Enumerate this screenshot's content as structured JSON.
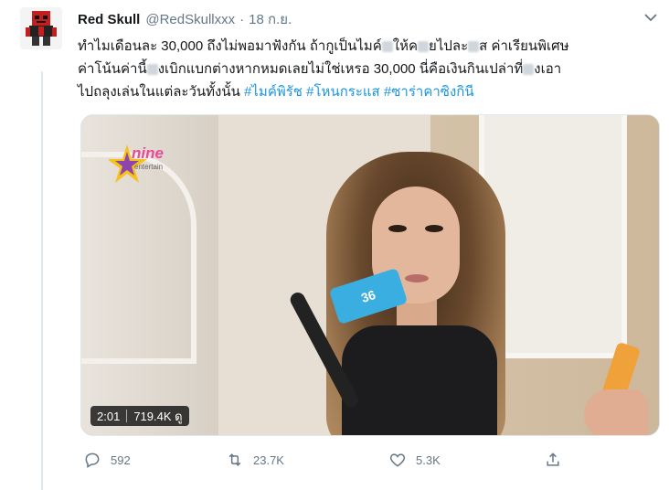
{
  "tweet": {
    "author_name": "Red Skull",
    "handle": "@RedSkullxxx",
    "separator": "·",
    "date": "18 ก.ย.",
    "text_line1_a": "ทำไมเดือนละ 30,000 ถึงไม่พอมาฟังกัน ถ้ากูเป็นไมค์",
    "text_line1_b": "ให้ค",
    "text_line1_c": "ยไปละ",
    "text_line1_d": "ส ค่าเรียนพิเศษ",
    "text_line2_a": "ค่าโน้นค่านี้",
    "text_line2_b": "งเบิกแบกต่างหากหมดเลยไม่ใช่เหรอ 30,000 นี่คือเงินกินเปล่าที่",
    "text_line2_c": "งเอา",
    "text_line3_a": "ไปถลุงเล่นในแต่ละวันทั้งนั้น ",
    "hashtags": [
      "#ไมค์พิรัช",
      "#โหนกระแส",
      "#ซาร่าคาซิงกินี"
    ]
  },
  "video": {
    "duration": "2:01",
    "views": "719.4K ดู",
    "logo_text": "nine",
    "logo_sub": "entertain",
    "mic_label": "36"
  },
  "actions": {
    "reply_count": "592",
    "retweet_count": "23.7K",
    "like_count": "5.3K"
  },
  "colors": {
    "link": "#1b95e0",
    "secondary_text": "#657786"
  },
  "icons": [
    "avatar-robot-icon",
    "chevron-down-icon",
    "reply-icon",
    "retweet-icon",
    "like-icon",
    "share-icon"
  ]
}
